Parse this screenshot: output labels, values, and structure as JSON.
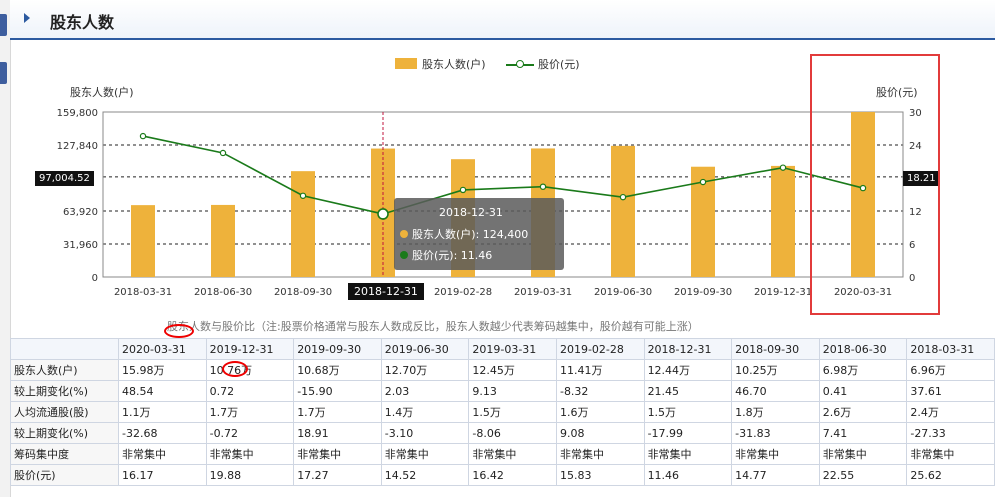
{
  "header": {
    "title": "股东人数"
  },
  "legend": {
    "bar_label": "股东人数(户)",
    "line_label": "股价(元)"
  },
  "axes": {
    "left_title": "股东人数(户)",
    "right_title": "股价(元)"
  },
  "tooltip": {
    "date": "2018-12-31",
    "holders_text": "股东人数(户): 124,400",
    "price_text": "股价(元): 11.46"
  },
  "crosshair": {
    "left_value": "97,004.52",
    "right_value": "18.21",
    "x_label": "2018-12-31"
  },
  "note": "股东人数与股价比（注:股票价格通常与股东人数成反比，股东人数越少代表筹码越集中，股价越有可能上涨）",
  "colors": {
    "bar": "#eeb23b",
    "line": "#1a7a1a",
    "highlight_box": "#e23b3b",
    "header_accent": "#2c5aa0"
  },
  "chart_data": {
    "type": "bar",
    "categories": [
      "2018-03-31",
      "2018-06-30",
      "2018-09-30",
      "2018-12-31",
      "2019-02-28",
      "2019-03-31",
      "2019-06-30",
      "2019-09-30",
      "2019-12-31",
      "2020-03-31"
    ],
    "series": [
      {
        "name": "股东人数(户)",
        "type": "bar",
        "axis": "left",
        "values": [
          69600,
          69800,
          102500,
          124400,
          114100,
          124500,
          127000,
          106800,
          107600,
          159800
        ]
      },
      {
        "name": "股价(元)",
        "type": "line",
        "axis": "right",
        "values": [
          25.62,
          22.55,
          14.77,
          11.46,
          15.83,
          16.42,
          14.52,
          17.27,
          19.88,
          16.17
        ]
      }
    ],
    "left_axis": {
      "ticks": [
        "0",
        "31,960",
        "63,920",
        "97,004.52",
        "127,840",
        "159,800"
      ],
      "ylim": [
        0,
        159800
      ]
    },
    "right_axis": {
      "ticks": [
        "0",
        "6",
        "12",
        "18.21",
        "24",
        "30"
      ],
      "ylim": [
        0,
        30
      ]
    },
    "grid": true,
    "legend_position": "top-center"
  },
  "table": {
    "headers": [
      "",
      "2020-03-31",
      "2019-12-31",
      "2019-09-30",
      "2019-06-30",
      "2019-03-31",
      "2019-02-28",
      "2018-12-31",
      "2018-09-30",
      "2018-06-30",
      "2018-03-31"
    ],
    "rows": [
      {
        "label": "股东人数(户)",
        "cells": [
          "15.98万",
          "10.76万",
          "10.68万",
          "12.70万",
          "12.45万",
          "11.41万",
          "12.44万",
          "10.25万",
          "6.98万",
          "6.96万"
        ]
      },
      {
        "label": "较上期变化(%)",
        "cells": [
          "48.54",
          "0.72",
          "-15.90",
          "2.03",
          "9.13",
          "-8.32",
          "21.45",
          "46.70",
          "0.41",
          "37.61"
        ]
      },
      {
        "label": "人均流通股(股)",
        "cells": [
          "1.1万",
          "1.7万",
          "1.7万",
          "1.4万",
          "1.5万",
          "1.6万",
          "1.5万",
          "1.8万",
          "2.6万",
          "2.4万"
        ]
      },
      {
        "label": "较上期变化(%)",
        "cells": [
          "-32.68",
          "-0.72",
          "18.91",
          "-3.10",
          "-8.06",
          "9.08",
          "-17.99",
          "-31.83",
          "7.41",
          "-27.33"
        ]
      },
      {
        "label": "筹码集中度",
        "cells": [
          "非常集中",
          "非常集中",
          "非常集中",
          "非常集中",
          "非常集中",
          "非常集中",
          "非常集中",
          "非常集中",
          "非常集中",
          "非常集中"
        ]
      },
      {
        "label": "股价(元)",
        "cells": [
          "16.17",
          "19.88",
          "17.27",
          "14.52",
          "16.42",
          "15.83",
          "11.46",
          "14.77",
          "22.55",
          "25.62"
        ]
      }
    ]
  }
}
